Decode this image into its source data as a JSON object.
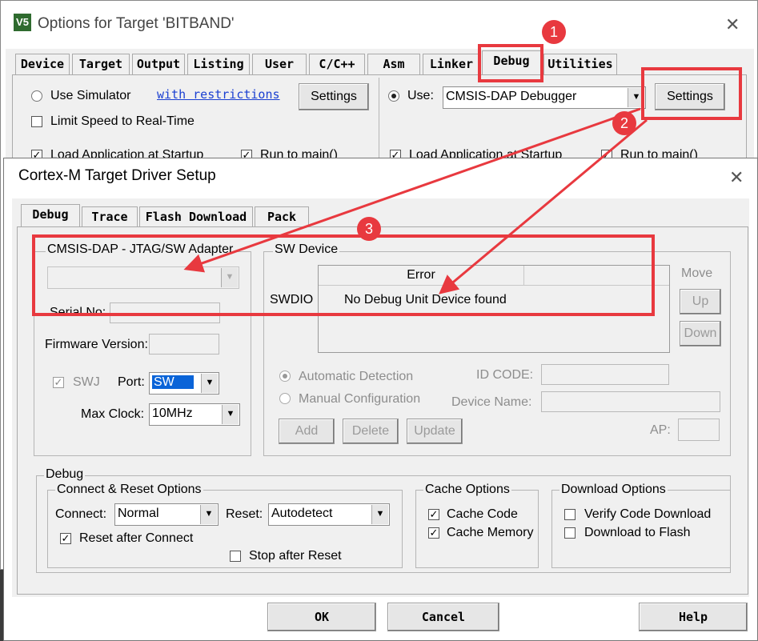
{
  "outer_window": {
    "icon_text": "V5",
    "title": "Options for Target 'BITBAND'",
    "tabs": [
      "Device",
      "Target",
      "Output",
      "Listing",
      "User",
      "C/C++",
      "Asm",
      "Linker",
      "Debug",
      "Utilities"
    ],
    "active_tab": "Debug",
    "use_simulator_label": "Use Simulator",
    "with_restrictions_link": "with restrictions",
    "settings_left_label": "Settings",
    "limit_speed_label": "Limit Speed to Real-Time",
    "use_label": "Use:",
    "debugger_value": "CMSIS-DAP Debugger",
    "settings_right_label": "Settings",
    "load_app_label": "Load Application at Startup",
    "run_to_main_label": "Run to main()"
  },
  "dialog": {
    "title": "Cortex-M Target Driver Setup",
    "tabs": [
      "Debug",
      "Trace",
      "Flash Download",
      "Pack"
    ],
    "active_tab": "Debug",
    "adapter_group": "CMSIS-DAP - JTAG/SW Adapter",
    "serial_no_label": "Serial No:",
    "firmware_version_label": "Firmware Version:",
    "swj_label": "SWJ",
    "port_label": "Port:",
    "port_value": "SW",
    "max_clock_label": "Max Clock:",
    "max_clock_value": "10MHz",
    "sw_device_group": "SW Device",
    "swdio_label": "SWDIO",
    "table_header": "Error",
    "table_message": "No Debug Unit Device found",
    "move_label": "Move",
    "up_label": "Up",
    "down_label": "Down",
    "auto_detect_label": "Automatic Detection",
    "manual_config_label": "Manual Configuration",
    "id_code_label": "ID CODE:",
    "device_name_label": "Device Name:",
    "add_label": "Add",
    "delete_label": "Delete",
    "update_label": "Update",
    "ap_label": "AP:",
    "debug_group": "Debug",
    "connect_reset_group": "Connect & Reset Options",
    "connect_label": "Connect:",
    "connect_value": "Normal",
    "reset_label": "Reset:",
    "reset_value": "Autodetect",
    "reset_after_connect_label": "Reset after Connect",
    "stop_after_reset_label": "Stop after Reset",
    "cache_group": "Cache Options",
    "cache_code_label": "Cache Code",
    "cache_memory_label": "Cache Memory",
    "download_group": "Download Options",
    "verify_code_label": "Verify Code Download",
    "download_flash_label": "Download to Flash",
    "ok_label": "OK",
    "cancel_label": "Cancel",
    "help_label": "Help"
  },
  "annotations": {
    "badge_1": "1",
    "badge_2": "2",
    "badge_3": "3",
    "color": "#e8393f"
  }
}
